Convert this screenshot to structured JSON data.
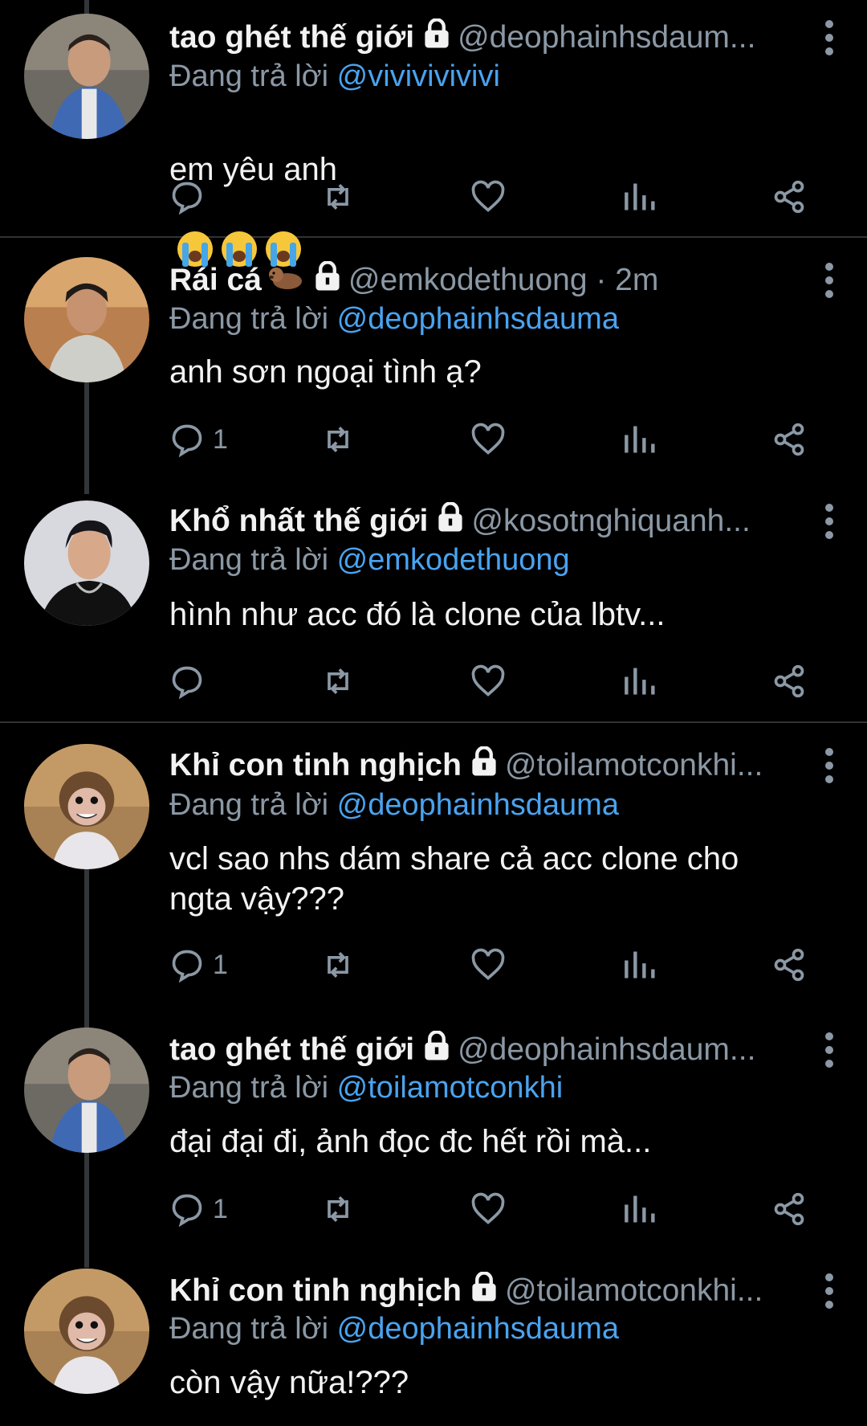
{
  "tweets": [
    {
      "name": "tao ghét thế giới",
      "handle": "@deophainhsdaum...",
      "reply_prefix": "Đang trả lời",
      "reply_to": "@vivivivivivi",
      "text": "em yêu anh",
      "text_emoji": "loudly-crying-face x3",
      "reply_count": "",
      "avatar": "child-photo"
    },
    {
      "name": "Rái cá",
      "name_emoji": "otter",
      "handle": "@emkodethuong · 2m",
      "reply_prefix": "Đang trả lời",
      "reply_to": "@deophainhsdauma",
      "text": "anh sơn ngoại tình ạ?",
      "reply_count": "1",
      "avatar": "young-man-photo"
    },
    {
      "name": "Khổ nhất thế giới",
      "handle": "@kosotnghiquanh...",
      "reply_prefix": "Đang trả lời",
      "reply_to": "@emkodethuong",
      "text": "hình như acc đó là clone của lbtv...",
      "reply_count": "",
      "avatar": "young-man-black-shirt-photo"
    },
    {
      "name": "Khỉ con tinh nghịch",
      "handle": "@toilamotconkhi...",
      "reply_prefix": "Đang trả lời",
      "reply_to": "@deophainhsdauma",
      "text": "vcl sao nhs dám share cả acc clone cho\nngta vậy???",
      "reply_count": "1",
      "avatar": "baby-monkey-photo"
    },
    {
      "name": "tao ghét thế giới",
      "handle": "@deophainhsdaum...",
      "reply_prefix": "Đang trả lời",
      "reply_to": "@toilamotconkhi",
      "text": "đại đại đi, ảnh đọc đc hết rồi mà...",
      "reply_count": "1",
      "avatar": "child-photo"
    },
    {
      "name": "Khỉ con tinh nghịch",
      "handle": "@toilamotconkhi...",
      "reply_prefix": "Đang trả lời",
      "reply_to": "@deophainhsdauma",
      "text": "còn vậy nữa!???",
      "reply_count": "",
      "avatar": "baby-monkey-photo"
    }
  ],
  "icons": {
    "lock": "lock-icon",
    "more": "more-vertical-icon",
    "reply": "reply-bubble-icon",
    "retweet": "retweet-icon",
    "like": "heart-icon",
    "views": "analytics-icon",
    "share": "share-icon"
  },
  "colors": {
    "background": "#000000",
    "mention": "#4aa3ef",
    "muted": "#8b98a5",
    "text": "#f2f2f2"
  }
}
